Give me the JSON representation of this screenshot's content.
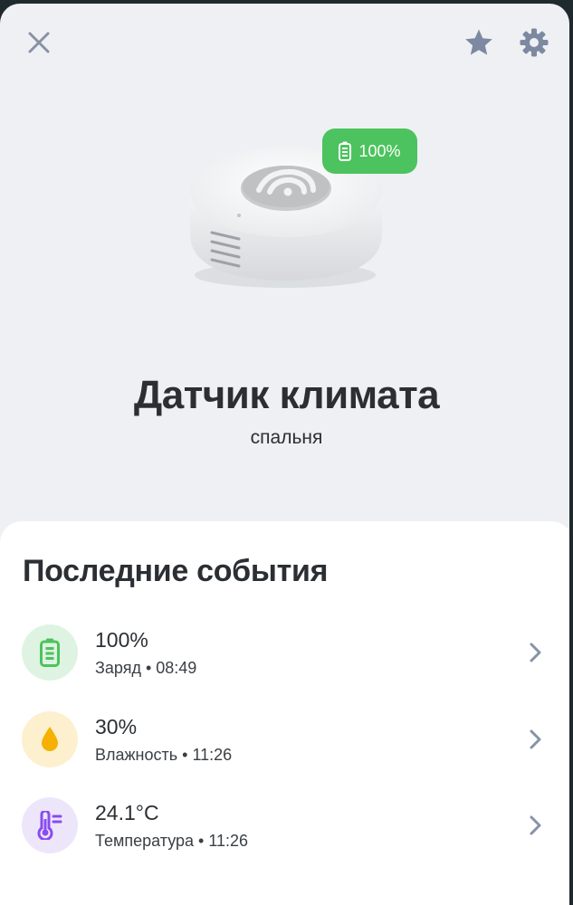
{
  "header": {
    "close_icon": "close-icon",
    "favorite_icon": "star-icon",
    "settings_icon": "gear-icon"
  },
  "device": {
    "name": "Датчик климата",
    "room": "спальня",
    "battery_badge": "100%",
    "battery_level": 1.0
  },
  "events": {
    "title": "Последние события",
    "items": [
      {
        "value": "100%",
        "meta": "Заряд • 08:49",
        "icon": "battery-icon",
        "icon_color": "#4cc35e",
        "icon_bg": "#dff3e2"
      },
      {
        "value": "30%",
        "meta": "Влажность • 11:26",
        "icon": "water-drop-icon",
        "icon_color": "#f5b000",
        "icon_bg": "#fdf0cf"
      },
      {
        "value": "24.1°C",
        "meta": "Температура • 11:26",
        "icon": "thermometer-icon",
        "icon_color": "#8a4cf0",
        "icon_bg": "#ede6fb"
      }
    ]
  },
  "colors": {
    "accent_green": "#4cc35e",
    "icon_gray": "#8792a6"
  }
}
